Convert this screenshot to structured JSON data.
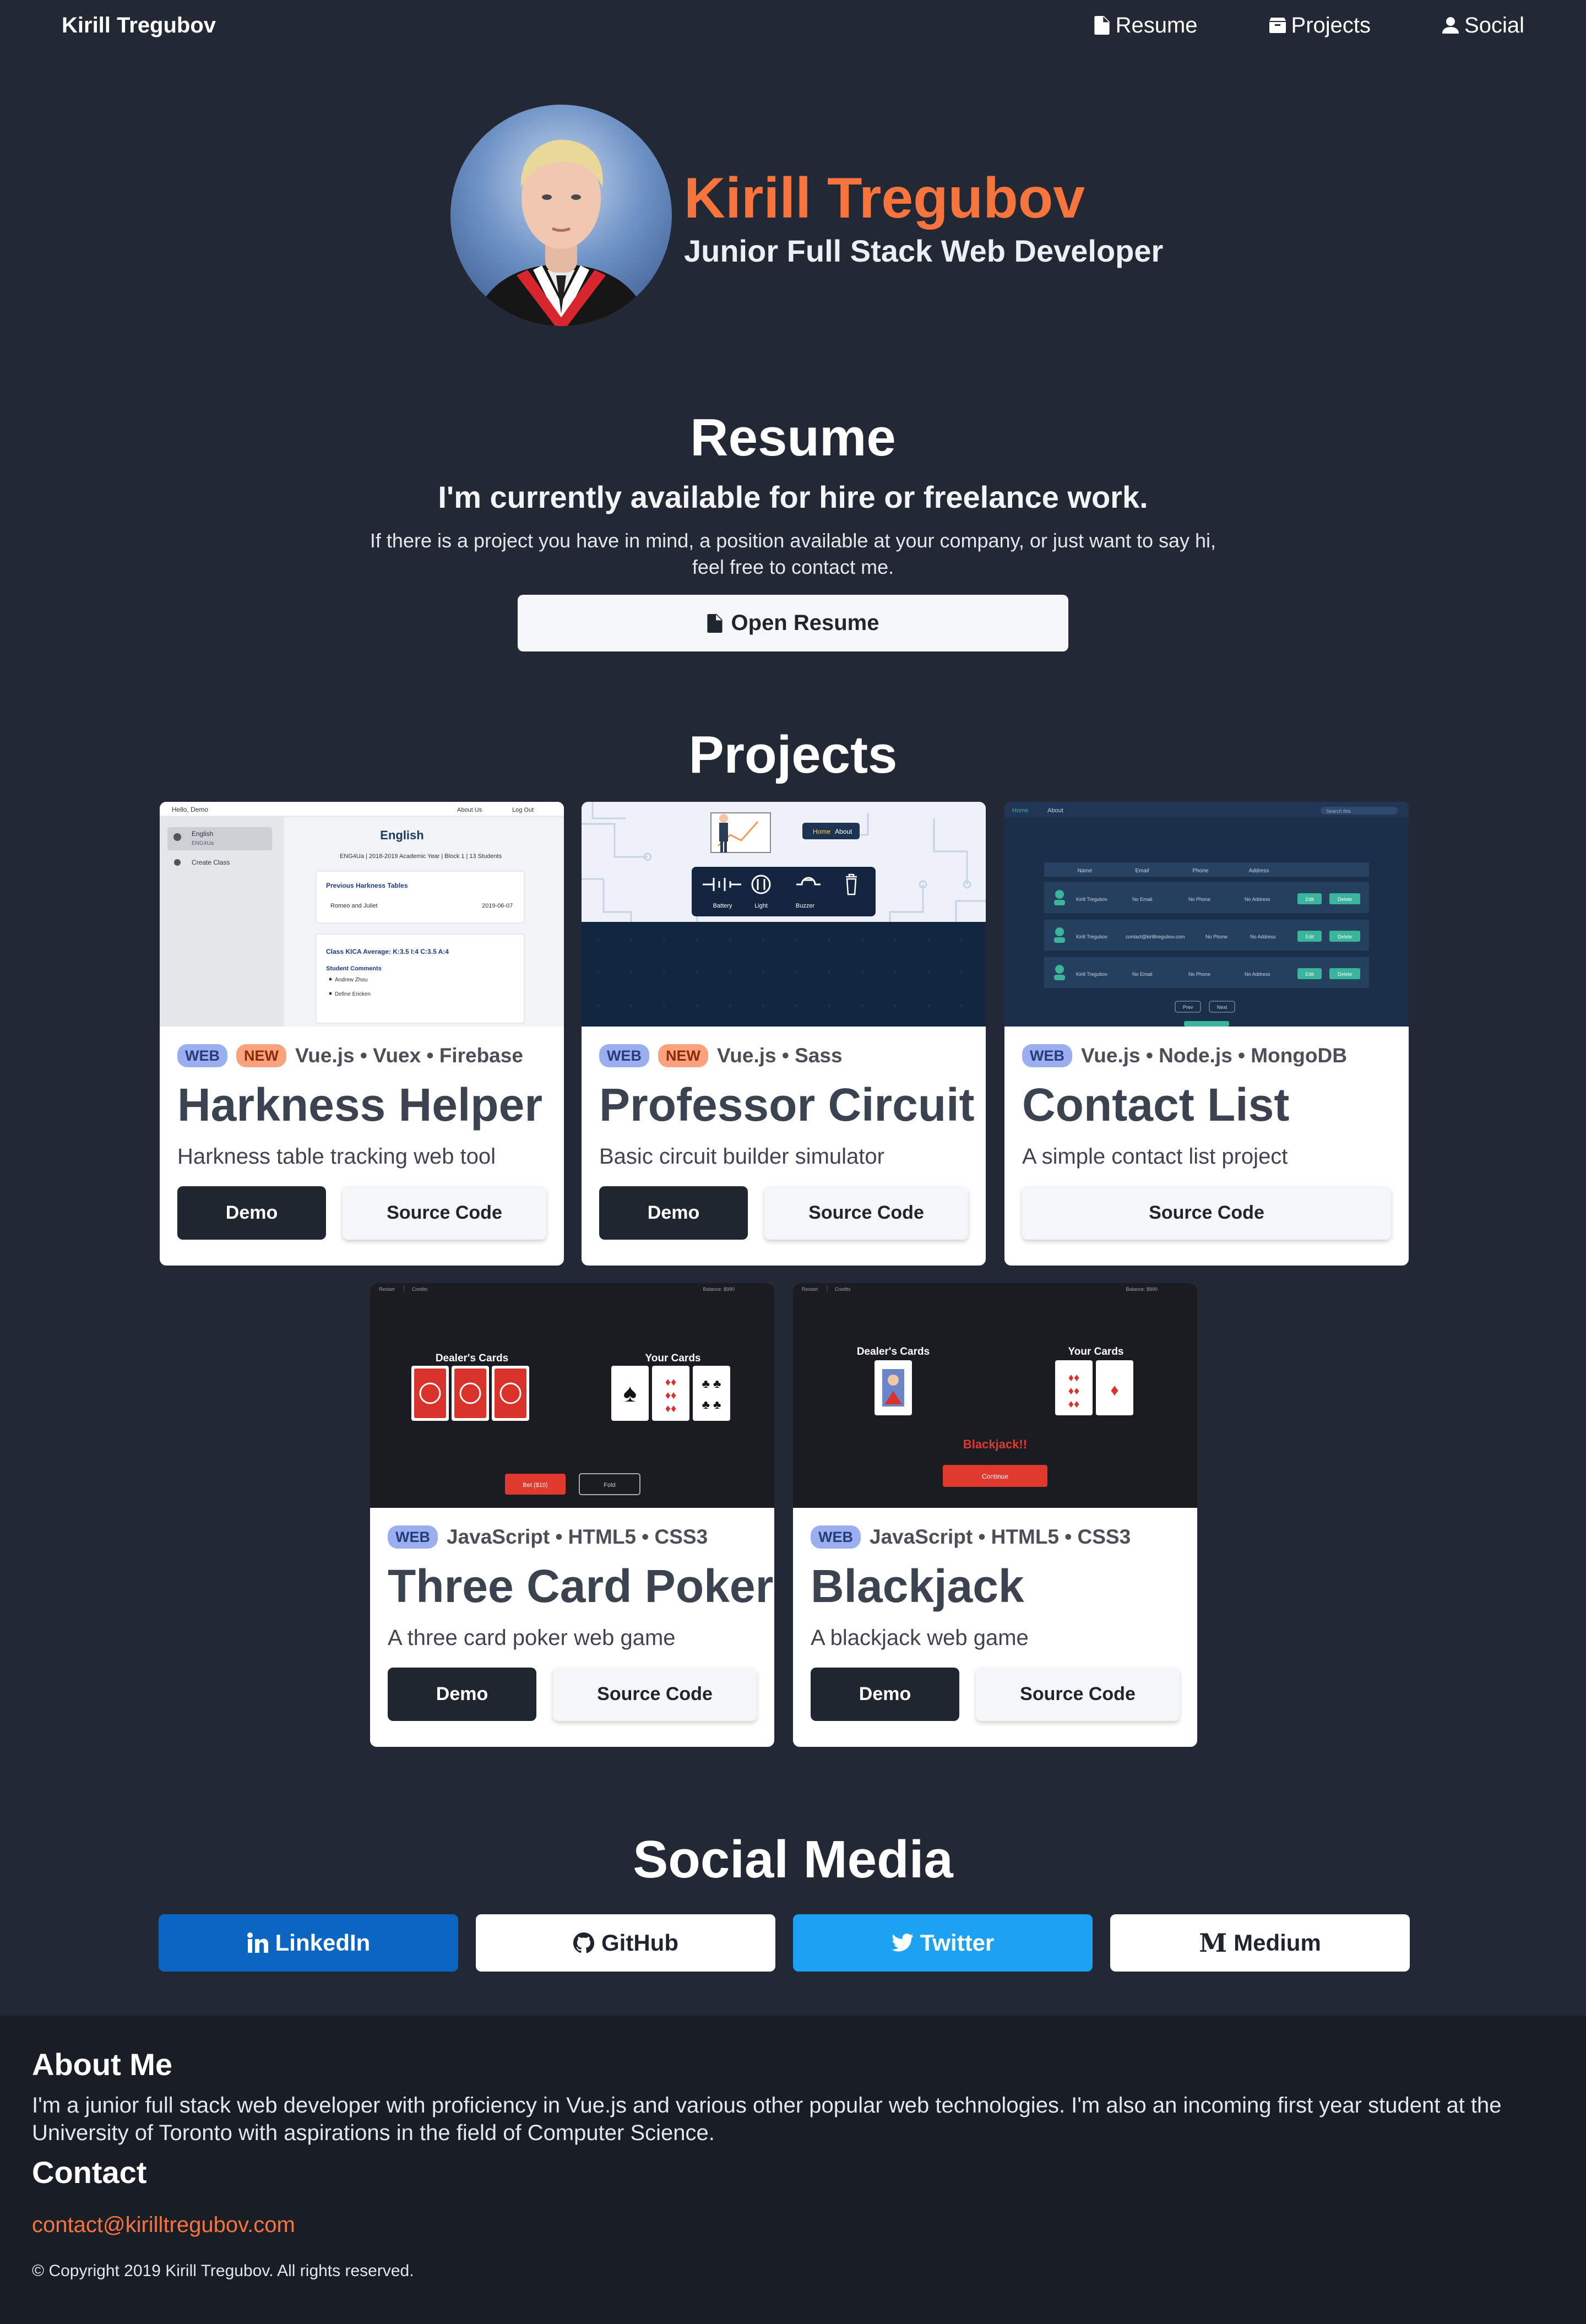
{
  "nav": {
    "brand": "Kirill Tregubov",
    "links": [
      {
        "label": "Resume",
        "icon": "file-icon"
      },
      {
        "label": "Projects",
        "icon": "box-icon"
      },
      {
        "label": "Social",
        "icon": "user-icon"
      }
    ]
  },
  "hero": {
    "name": "Kirill Tregubov",
    "subtitle": "Junior Full Stack Web Developer"
  },
  "resume": {
    "title": "Resume",
    "lead": "I'm currently available for hire or freelance work.",
    "description": "If there is a project you have in mind, a position available at your company, or just want to say hi, feel free to contact me.",
    "button_label": "Open Resume"
  },
  "projects": {
    "title": "Projects",
    "items": [
      {
        "badges": [
          "WEB",
          "NEW"
        ],
        "tech": "Vue.js • Vuex • Firebase",
        "title": "Harkness Helper",
        "description": "Harkness table tracking web tool",
        "demo_label": "Demo",
        "source_label": "Source Code"
      },
      {
        "badges": [
          "WEB",
          "NEW"
        ],
        "tech": "Vue.js • Sass",
        "title": "Professor Circuit",
        "description": "Basic circuit builder simulator",
        "demo_label": "Demo",
        "source_label": "Source Code"
      },
      {
        "badges": [
          "WEB"
        ],
        "tech": "Vue.js • Node.js • MongoDB",
        "title": "Contact List",
        "description": "A simple contact list project",
        "source_label": "Source Code"
      },
      {
        "badges": [
          "WEB"
        ],
        "tech": "JavaScript • HTML5 • CSS3",
        "title": "Three Card Poker",
        "description": "A three card poker web game",
        "demo_label": "Demo",
        "source_label": "Source Code"
      },
      {
        "badges": [
          "WEB"
        ],
        "tech": "JavaScript • HTML5 • CSS3",
        "title": "Blackjack",
        "description": "A blackjack web game",
        "demo_label": "Demo",
        "source_label": "Source Code"
      }
    ],
    "thumbs": {
      "harkness": {
        "greeting": "Hello, Demo",
        "about": "About Us",
        "logout": "Log Out",
        "sidebar_item": "English",
        "sidebar_sub": "ENG4Ua",
        "create": "Create Class",
        "heading": "English",
        "meta": "ENG4Ua | 2018-2019 Academic Year | Block 1 | 13 Students",
        "prev_title": "Previous Harkness Tables",
        "prev_row": "Romeo and Juliet",
        "prev_date": "2019-06-07",
        "kica": "Class KICA Average: K:3.5 I:4 C:3.5 A:4",
        "comments": "Student Comments",
        "c1": "Andrew Zhou",
        "c2": "Define Ericken"
      },
      "circuit": {
        "crumb_home": "Home",
        "crumb_about": "About",
        "tools": [
          "Battery",
          "Light",
          "Buzzer"
        ]
      },
      "contact": {
        "nav_home": "Home",
        "nav_about": "About",
        "search": "Search this",
        "headers": [
          "Name",
          "Email",
          "Phone",
          "Address"
        ],
        "rows": [
          [
            "Kirill Tregubov",
            "No Email",
            "No Phone",
            "No Address"
          ],
          [
            "Kirill Tregubov",
            "contact@kirilltregubov.com",
            "No Phone",
            "No Address"
          ],
          [
            "Kirill Tregubov",
            "No Email",
            "No Phone",
            "No Address"
          ]
        ],
        "edit": "Edit",
        "delete": "Delete",
        "prev": "Prev",
        "next": "Next"
      },
      "poker": {
        "restart": "Restart",
        "credits": "Credits",
        "balance": "Balance: $990",
        "dealer": "Dealer's Cards",
        "yours": "Your Cards",
        "bet": "Bet ($10)",
        "fold": "Fold"
      },
      "blackjack": {
        "restart": "Restart",
        "credits": "Credits",
        "balance": "Balance: $990",
        "dealer": "Dealer's Cards",
        "yours": "Your Cards",
        "result": "Blackjack!!",
        "continue": "Continue"
      }
    }
  },
  "social": {
    "title": "Social Media",
    "links": [
      {
        "label": "LinkedIn",
        "color": "#0a66c2"
      },
      {
        "label": "GitHub",
        "color": "#ffffff"
      },
      {
        "label": "Twitter",
        "color": "#1da1f2"
      },
      {
        "label": "Medium",
        "color": "#ffffff",
        "glyph": "M"
      }
    ]
  },
  "footer": {
    "about_title": "About Me",
    "about_text": "I'm a junior full stack web developer with proficiency in Vue.js and various other popular web technologies. I'm also an incoming first year student at the University of Toronto with aspirations in the field of Computer Science.",
    "contact_title": "Contact",
    "email": "contact@kirilltregubov.com",
    "copyright": "© Copyright 2019 Kirill Tregubov. All rights reserved."
  },
  "colors": {
    "background": "#222834",
    "footer_bg": "#191d25",
    "accent": "#f7743d",
    "dark_button": "#20262f"
  }
}
